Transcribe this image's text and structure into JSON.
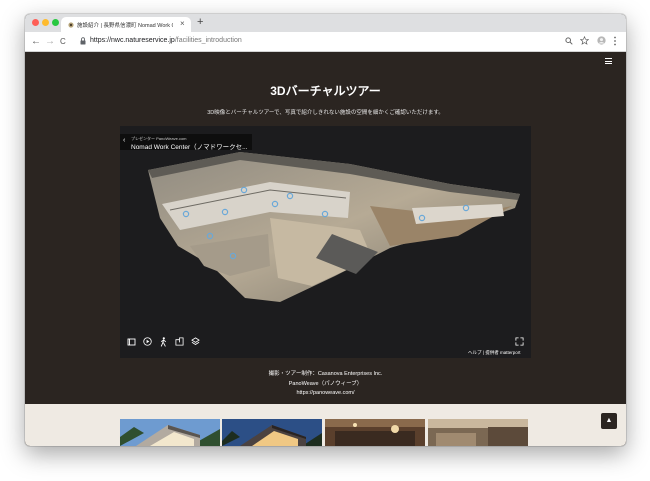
{
  "browser": {
    "tab_title": "施設紹介 | 長野県信濃町 Nomad Work Center",
    "new_tab_symbol": "+",
    "close_symbol": "×",
    "url_domain": "https://nwc.natureservice.jp",
    "url_path": "/facilities_introduction",
    "back_symbol": "←",
    "forward_symbol": "→",
    "reload_symbol": "C",
    "traffic_colors": [
      "#fe5f57",
      "#febb2e",
      "#28c840"
    ]
  },
  "page": {
    "title": "3Dバーチャルツアー",
    "subtitle": "3D映像とバーチャルツアーで、写真で紹介しきれない施設の空間を細かくご確認いただけます。",
    "viewer": {
      "presenter": "プレゼンター PanoWeave.com",
      "title": "Nomad Work Center（ノマドワークセ...",
      "back_symbol": "‹",
      "footer_help": "ヘルプ",
      "footer_sep": "|",
      "footer_powered": "提供者 matterport"
    },
    "credits": {
      "line1": "撮影・ツアー制作：Casanova Enterprises Inc.",
      "line2": "PanoWeave（パノウィーブ）",
      "line3": "https://panoweave.com/"
    },
    "back_to_top_symbol": "▲"
  },
  "colors": {
    "page_bg": "#2b2521",
    "lower_bg": "#efeae3",
    "viewer_bg": "#1c1c1e"
  },
  "icons": [
    "menu-icon",
    "search-icon",
    "star-icon",
    "account-icon",
    "more-icon",
    "lock-icon",
    "dollhouse-icon",
    "play-icon",
    "walk-icon",
    "floorplan-icon",
    "layers-icon",
    "fullscreen-icon",
    "caret-up-icon"
  ]
}
